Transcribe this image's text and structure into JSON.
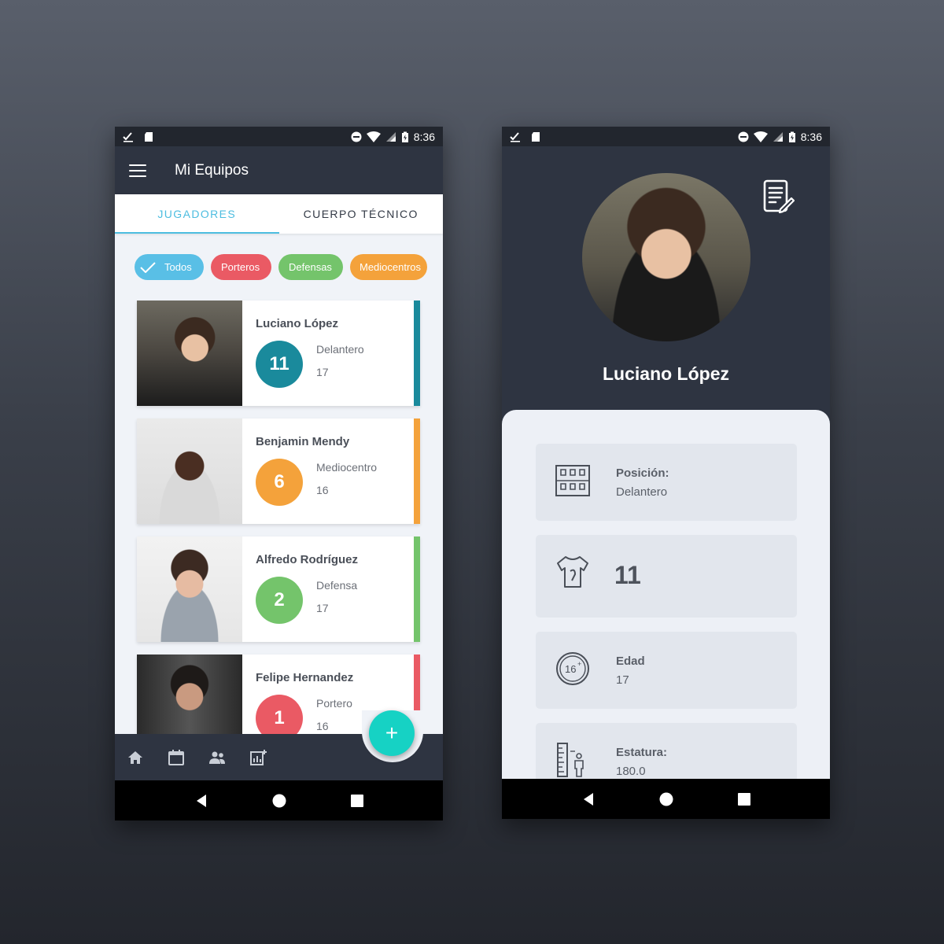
{
  "status_bar": {
    "time": "8:36"
  },
  "left_screen": {
    "title": "Mi Equipos",
    "tabs": [
      {
        "label": "JUGADORES",
        "active": true
      },
      {
        "label": "CUERPO TÉCNICO",
        "active": false
      }
    ],
    "filters": [
      {
        "label": "Todos",
        "color": "#59bfe6",
        "selected": true
      },
      {
        "label": "Porteros",
        "color": "#ea5a64",
        "selected": false
      },
      {
        "label": "Defensas",
        "color": "#74c46b",
        "selected": false
      },
      {
        "label": "Mediocentros",
        "color": "#f4a23b",
        "selected": false
      }
    ],
    "players": [
      {
        "name": "Luciano López",
        "number": "11",
        "position": "Delantero",
        "age": "17",
        "color": "#1a8a9c"
      },
      {
        "name": "Benjamin Mendy",
        "number": "6",
        "position": "Mediocentro",
        "age": "16",
        "color": "#f4a23b"
      },
      {
        "name": "Alfredo Rodríguez",
        "number": "2",
        "position": "Defensa",
        "age": "17",
        "color": "#74c46b"
      },
      {
        "name": "Felipe Hernandez",
        "number": "1",
        "position": "Portero",
        "age": "16",
        "color": "#ea5a64"
      }
    ],
    "fab_symbol": "+",
    "bottom_nav": [
      "home-icon",
      "calendar-icon",
      "people-icon",
      "stats-icon"
    ]
  },
  "right_screen": {
    "name": "Luciano López",
    "details": {
      "position_label": "Posición:",
      "position_value": "Delantero",
      "number_value": "11",
      "age_label": "Edad",
      "age_value": "17",
      "height_label": "Estatura:",
      "height_value": "180.0"
    }
  }
}
